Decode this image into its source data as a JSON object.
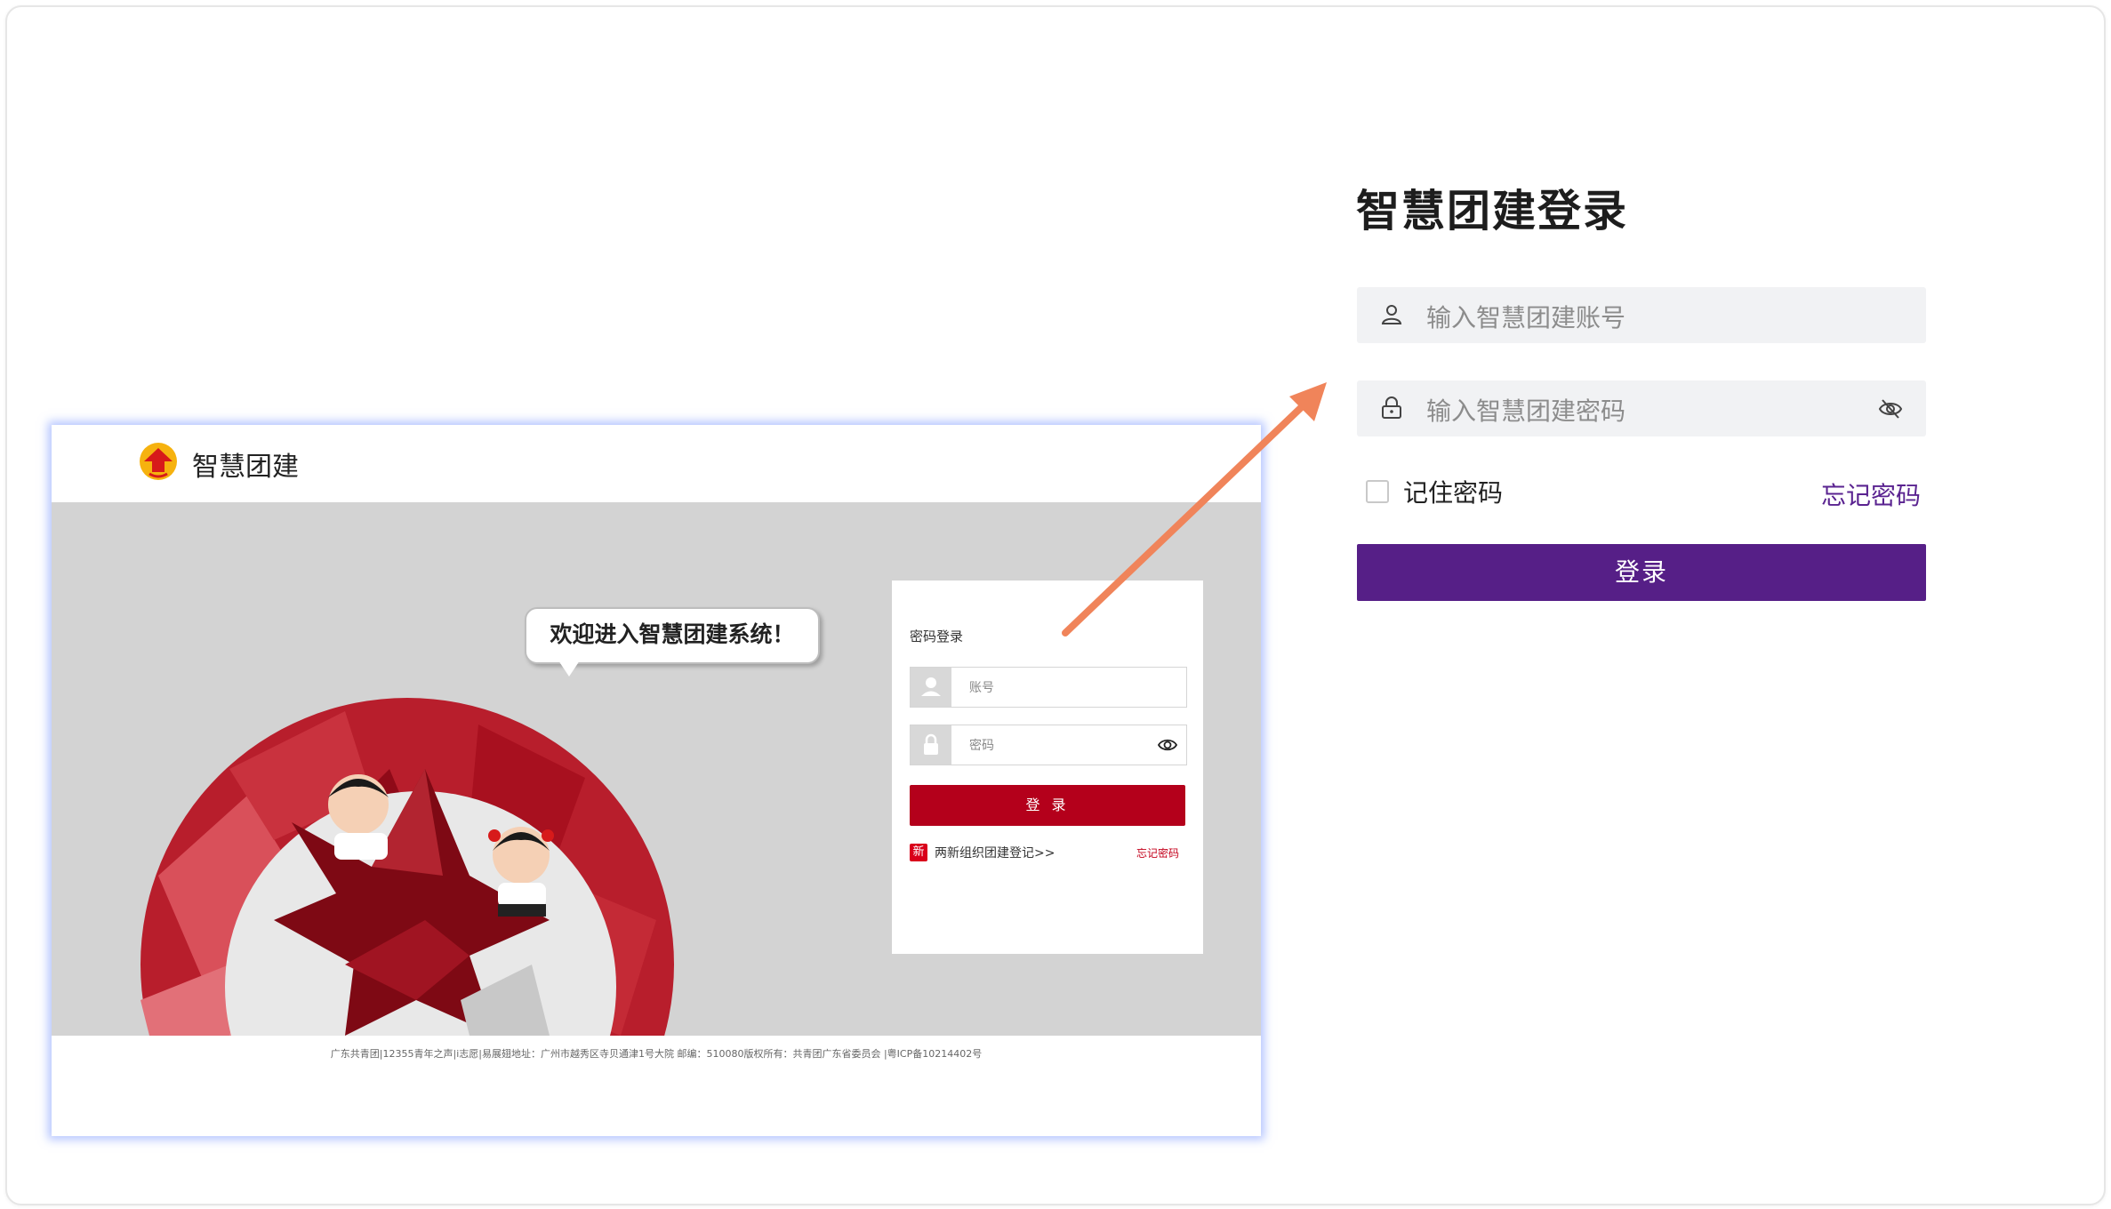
{
  "login": {
    "title": "智慧团建登录",
    "account_placeholder": "输入智慧团建账号",
    "password_placeholder": "输入智慧团建密码",
    "remember_label": "记住密码",
    "forgot_label": "忘记密码",
    "submit_label": "登录",
    "accent": "#561f87"
  },
  "old_site": {
    "brand": "智慧团建",
    "welcome": "欢迎进入智慧团建系统！",
    "card": {
      "title": "密码登录",
      "account_placeholder": "账号",
      "password_placeholder": "密码",
      "submit_label": "登 录",
      "new_badge": "新",
      "register_link": "两新组织团建登记>>",
      "forgot_label": "忘记密码"
    },
    "footer": "广东共青团|12355青年之声|i志愿|易展翅地址：广州市越秀区寺贝通津1号大院 邮编：510080版权所有：共青团广东省委员会 |粤ICP备10214402号",
    "accent": "#b4001b"
  },
  "annotation": {
    "arrow_color": "#f0845a"
  },
  "icons": [
    "user-icon",
    "lock-icon",
    "eye-off-icon",
    "logo-icon",
    "eye-icon",
    "user-icon-small",
    "lock-icon-small",
    "arrow-icon"
  ]
}
